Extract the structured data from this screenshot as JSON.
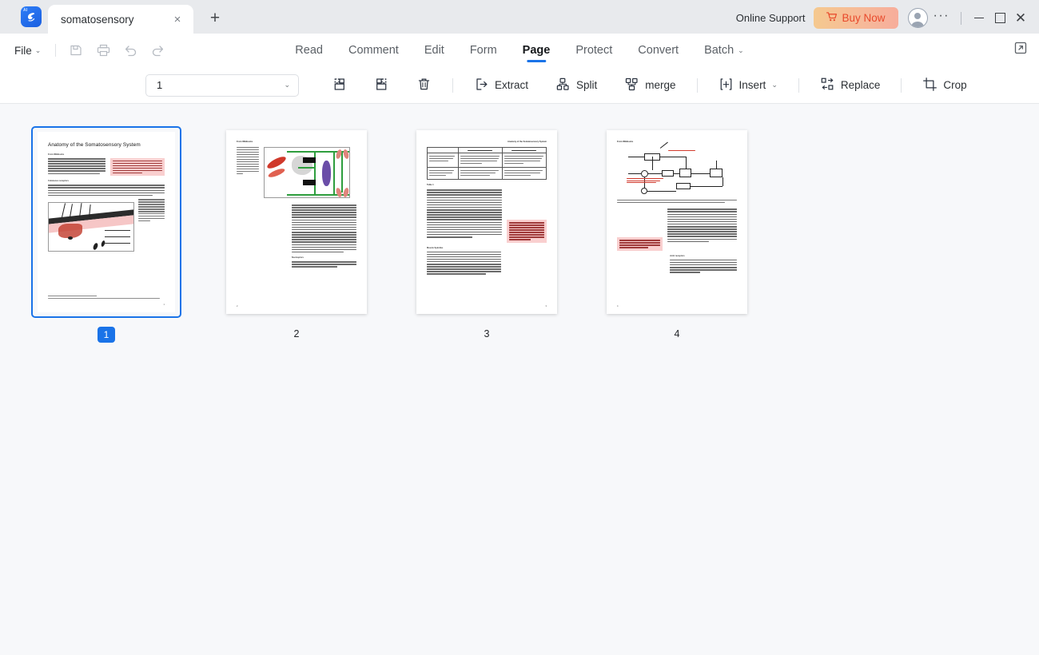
{
  "titlebar": {
    "app_icon": "app-logo-icon",
    "app_badge": "AI",
    "app_glyph": "⌇",
    "document_tab": "somatosensory",
    "close_tab_icon": "×",
    "new_tab_icon": "+",
    "online_support": "Online Support",
    "buy_now": "Buy Now",
    "cart_icon": "🛒",
    "ellipsis": "···",
    "close_icon": "✕"
  },
  "menubar": {
    "file": "File",
    "chevron": "⌄",
    "quick_actions": [
      "save-icon",
      "print-icon",
      "undo-icon",
      "redo-icon"
    ],
    "tabs": [
      {
        "label": "Read",
        "active": false
      },
      {
        "label": "Comment",
        "active": false
      },
      {
        "label": "Edit",
        "active": false
      },
      {
        "label": "Form",
        "active": false
      },
      {
        "label": "Page",
        "active": true
      },
      {
        "label": "Protect",
        "active": false
      },
      {
        "label": "Convert",
        "active": false
      },
      {
        "label": "Batch",
        "active": false,
        "has_chevron": true
      }
    ],
    "expand_icon": "expand-window-icon"
  },
  "toolbar": {
    "page_select_value": "1",
    "page_select_chevron": "⌄",
    "items": [
      {
        "label": "",
        "icon": "insert-page-left-icon"
      },
      {
        "label": "",
        "icon": "insert-page-right-icon"
      },
      {
        "label": "",
        "icon": "delete-page-icon"
      },
      {
        "label": "Extract",
        "icon": "extract-icon"
      },
      {
        "label": "Split",
        "icon": "split-icon"
      },
      {
        "label": "merge",
        "icon": "merge-icon"
      },
      {
        "label": "Insert",
        "icon": "insert-icon",
        "has_chevron": true
      },
      {
        "label": "Replace",
        "icon": "replace-icon"
      },
      {
        "label": "Crop",
        "icon": "crop-icon"
      }
    ]
  },
  "pages": [
    {
      "number": "1",
      "selected": true,
      "title": "Anatomy of the Somatosensory System",
      "header": "",
      "section1": "From Wikibooks",
      "section2": "Cutaneous receptors",
      "callout": "This is a sample document to showcase page-based formatting. It contains a chapter from a Wikibook called Sensory Systems. None of the content has been changed in this article, but some content has been removed.",
      "figure_caption": "Figure 1:  Receptors in the human skin: Mechanoreceptors can be free receptors or encapsulated. Examples for free receptors are the hair receptors at the roots of hairs. Encapsulated receptors are the Pacinian corpuscles and the receptors in the glabrous (hairless) skin: Meissner corpuscles, Ruffini corpuscles and Merkel's disks.",
      "footnote": "* The following description is based on lecture notes from Laszlo Zaborszky, from Rutgers University.",
      "page_num": "1"
    },
    {
      "number": "2",
      "selected": false,
      "title": "",
      "header": "From Wikibooks",
      "figure_caption": "Figure 2:  Mammalian muscle spindle showing typical position in a muscle (left), neuronal connections in spinal cord (middle) and expanded schematic (right). The spindle is a stretch receptor with its own motor supply consisting of several intrafusal muscle fibres. The sensory endings of a primary (group Ia) afferent and a secondary (group II) afferent coil around the non-contractile central portions of the intrafusal fibres.",
      "section1": "Nociceptors",
      "page_num": "2"
    },
    {
      "number": "3",
      "selected": false,
      "title": "",
      "header": "Anatomy of the Somatosensory System",
      "table": {
        "col_headers": [
          "",
          "Rapidly adapting",
          "Slowly adapting"
        ],
        "rows": [
          [
            "Surface receptor / small receptive field",
            "Hair receptor, Meissner's corpuscle: Detect an object is in very fine vibration. Used for recognizing texture.",
            "Merkel's receptor: Used for spatial details, e.g. a round surface edge or \"an X\" in brail."
          ],
          [
            "Deep receptor / large receptive field",
            "Pacinian corpuscle: \"A diffuse vibration\" e.g. tapping with a pencil.",
            "Ruffini's corpuscle: \"A skin stretch\". Used for joint position in fingers."
          ]
        ],
        "caption": "Table 1"
      },
      "section1": "Muscle Spindles",
      "callout": "Notice how figure captions and sidenotes are shown in the outside margin (on the left or right, depending on whether the page is left or right). Also, figures are floated to the top of the page. Whitecontent, like the table and Figure 3, intrude into the outside margins.",
      "page_num": "3"
    },
    {
      "number": "4",
      "selected": false,
      "title": "",
      "header": "From Wikibooks",
      "figure_caption": "Figure 3:  Feedback loops for proprioceptive signals for the perception and control of limb movements. Arrows indicate excitatory connections; filled circles inhibitory connections.",
      "diagram_labels": [
        "Gamma Bias",
        "Muscle",
        "Spindle",
        "Load",
        "Force",
        "Muscle Length"
      ],
      "diagram_annotation_red": "Length error Descending efferent / Steady-state value Joint and muscle afferents / Velocity gamma + alpha efferent",
      "callout": "For more examples of how to set HTML and CSS for paper-based publishing, see cnx.org/..",
      "section1": "Joint receptors",
      "page_num": "4"
    }
  ]
}
